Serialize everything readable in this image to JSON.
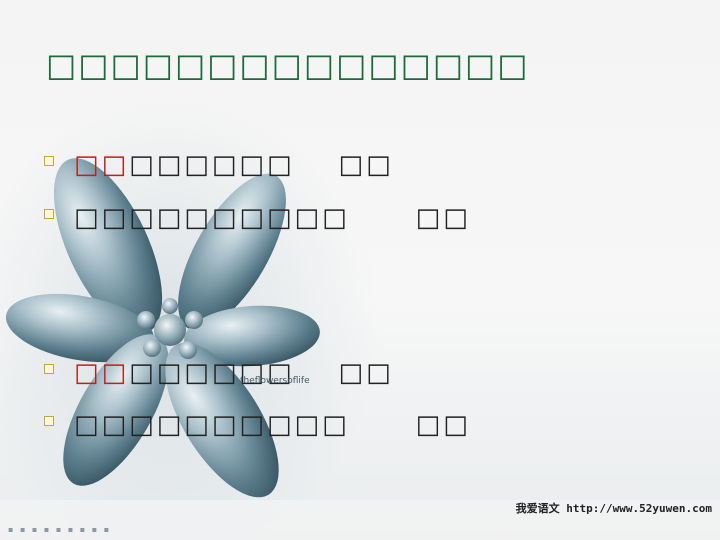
{
  "slide": {
    "title": "□□□□□□□□□□□□□□□",
    "bullets": [
      {
        "red": "□□",
        "rest": "□□□□□□",
        "tail": "□□"
      },
      {
        "red": "",
        "rest": "□□□□□□□□□□",
        "tail": "□□"
      },
      {
        "red": "□□",
        "rest": "□□□□□□",
        "tail": "□□"
      },
      {
        "red": "",
        "rest": "□□□□□□□□□□",
        "tail": "□□"
      }
    ]
  },
  "watermark": {
    "text": "theflowersoflife"
  },
  "footer": {
    "site": "我爱语文 http://www.52yuwen.com",
    "left": "▪ ▪ ▪ ▪ ▪ ▪ ▪ ▪ ▪"
  },
  "colors": {
    "title": "#1c6b3a",
    "highlight": "#c0201c",
    "bullet_marker": "#c9a43c",
    "flower": "#5d7f8e"
  },
  "icons": [
    "flower-graphic",
    "bullet-square-icon"
  ]
}
